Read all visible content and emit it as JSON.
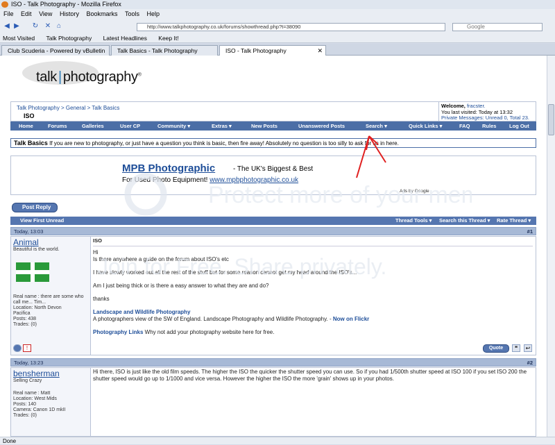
{
  "browser": {
    "window_title": "ISO - Talk Photography - Mozilla Firefox",
    "menu": [
      "File",
      "Edit",
      "View",
      "History",
      "Bookmarks",
      "Tools",
      "Help"
    ],
    "url": "http://www.talkphotography.co.uk/forums/showthread.php?t=38090",
    "search_placeholder": "Google",
    "bookmarks": [
      "Most Visited",
      "Talk Photography",
      "Latest Headlines",
      "Keep It!"
    ],
    "tabs": [
      {
        "label": "Club Scuderia - Powered by vBulletin",
        "active": false
      },
      {
        "label": "Talk Basics - Talk Photography",
        "active": false
      },
      {
        "label": "ISO - Talk Photography",
        "active": true
      }
    ],
    "status": "Done"
  },
  "site": {
    "logo_left": "talk",
    "logo_right": "photography",
    "logo_mark": "®"
  },
  "breadcrumb": {
    "path": "Talk Photography > General > Talk Basics",
    "current": "ISO"
  },
  "welcome": {
    "greeting": "Welcome,",
    "user": "fracster.",
    "last_visit": "You last visited: Today at 13:32",
    "pm": "Private Messages: Unread 0, Total 23."
  },
  "navbar": [
    "Home",
    "Forums",
    "Galleries",
    "User CP",
    "Community ▾",
    "Extras ▾",
    "New Posts",
    "Unanswered Posts",
    "Search ▾",
    "Quick Links ▾",
    "FAQ",
    "Rules",
    "Log Out"
  ],
  "forum_intro": {
    "forum": "Talk Basics",
    "text": "If you are new to photography, or just have a question you think is basic, then fire away! Absolutely no question is too silly to ask for us in here."
  },
  "ad": {
    "title": "MPB Photographic",
    "tagline": " - The UK's Biggest & Best",
    "line2": "For Used Photo Equipment! ",
    "url": "www.mpbphotographic.co.uk",
    "ads_by": "Ads by Google"
  },
  "buttons": {
    "post_reply": "Post Reply",
    "quote": "Quote"
  },
  "threadbar": {
    "first_unread": "View First Unread",
    "tools": "Thread Tools ▾",
    "search": "Search this Thread ▾",
    "rate": "Rate Thread ▾"
  },
  "posts": [
    {
      "date": "Today, 13:03",
      "num": "#1",
      "user": "Animal",
      "user_title": "Beautiful is the world.",
      "info": [
        "Real name : there are some who call me... Tim...",
        "Location: North Devon",
        "Pacifica",
        "Posts: 438",
        "Trades: (0)"
      ],
      "title": "ISO",
      "body": [
        "Hi",
        "Is there anywhere a guide on the forum about ISO's etc",
        "I have slowly worked out all the rest of the stuff but for some reason cannot get my head around the ISO's...",
        "Am I just being thick or is there a easy answer to what they are and do?",
        "thanks"
      ],
      "sig_title": "Landscape and Wildlife Photography",
      "sig_text": "A photographers view of the SW of England. Landscape Photography and Wildlife Photography. - ",
      "sig_link": "Now on Flickr",
      "sig2_title": "Photography Links",
      "sig2_text": " Why not add your photography website here for free."
    },
    {
      "date": "Today, 13:23",
      "num": "#2",
      "user": "bensherman",
      "user_title": "Selling Crazy",
      "info": [
        "Real name : Matt",
        "Location: West Mids",
        "Posts: 140",
        "Camera: Canon 1D mkII",
        "Trades: (0)"
      ],
      "body": [
        "Hi there, ISO is just like the old film speeds. The higher the ISO the quicker the shutter speed you can use. So if you had 1/500th shutter speed at ISO 100 if you set ISO 200 the shutter speed would go up to 1/1000 and vice versa. However the higher the ISO the more 'grain' shows up in your photos."
      ]
    }
  ],
  "watermark": {
    "line1": "Protect more of your memories for less!",
    "line2": "Join for Free. Share privately."
  }
}
